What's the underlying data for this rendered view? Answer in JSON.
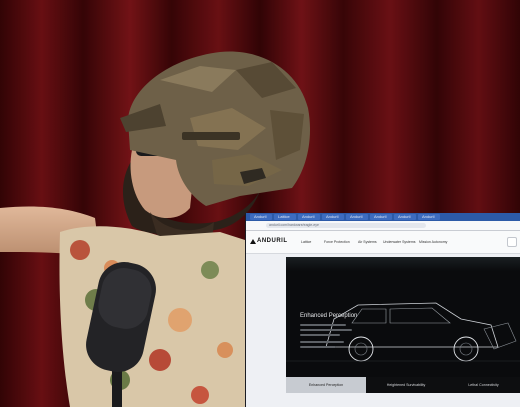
{
  "browser": {
    "tabs": [
      "Anduril",
      "Lattice",
      "Anduril",
      "Anduril",
      "Anduril",
      "Anduril",
      "Anduril",
      "Anduril"
    ],
    "url": "anduril.com/hardware/eagle-eye"
  },
  "site": {
    "logo": "ANDURIL",
    "nav_items": [
      "Lattice",
      "Force Protection",
      "Air Systems",
      "Underwater Systems",
      "Mission Autonomy"
    ]
  },
  "hero": {
    "title": "Enhanced Perception"
  },
  "feature_tabs": [
    {
      "label": "Enhanced Perception",
      "active": true
    },
    {
      "label": "Heightened Survivability",
      "active": false
    },
    {
      "label": "Lethal Connectivity",
      "active": false
    }
  ],
  "colors": {
    "curtain": "#5a0a0d",
    "helmet_camo": "#6e6048",
    "shirt": "#d9c7a8",
    "monitor_bg": "#eef0f4",
    "hero_bg": "#0a0b0d",
    "tab_active": "#c7cbd1"
  }
}
